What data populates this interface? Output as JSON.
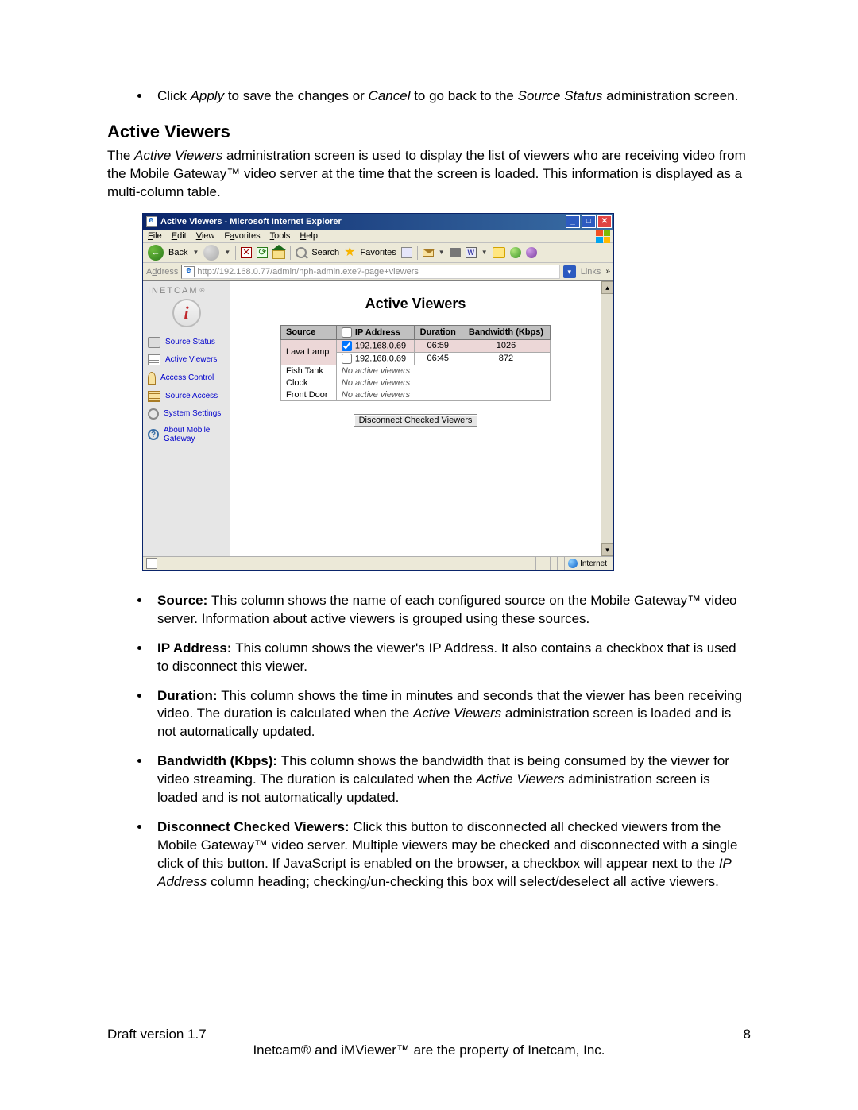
{
  "topBullet": {
    "pre": "Click ",
    "apply": "Apply",
    "mid1": " to save the changes or ",
    "cancel": "Cancel",
    "mid2": " to go back to the ",
    "srcStatus": "Source Status",
    "post": " administration screen."
  },
  "heading": "Active Viewers",
  "intro": {
    "pre": "The ",
    "term": "Active Viewers",
    "post": " administration screen is used to display the list of viewers who are receiving video from the Mobile Gateway™ video server at the time that the screen is loaded.  This information is displayed as a multi-column table."
  },
  "screenshot": {
    "title": "Active Viewers - Microsoft Internet Explorer",
    "menus": {
      "file": "File",
      "edit": "Edit",
      "view": "View",
      "favorites": "Favorites",
      "tools": "Tools",
      "help": "Help"
    },
    "toolbar": {
      "back": "Back",
      "search": "Search",
      "favorites": "Favorites"
    },
    "address": {
      "label": "Address",
      "url": "http://192.168.0.77/admin/nph-admin.exe?-page+viewers",
      "links": "Links"
    },
    "brand": "INETCAM",
    "logoGlyph": "i",
    "sidebar": [
      "Source Status",
      "Active Viewers",
      "Access Control",
      "Source Access",
      "System Settings",
      "About Mobile Gateway"
    ],
    "pageTitle": "Active Viewers",
    "table": {
      "headers": {
        "source": "Source",
        "ip": "IP Address",
        "duration": "Duration",
        "bw": "Bandwidth (Kbps)"
      },
      "rows": [
        {
          "source": "Lava Lamp",
          "viewers": [
            {
              "ip": "192.168.0.69",
              "checked": true,
              "duration": "06:59",
              "bw": "1026"
            },
            {
              "ip": "192.168.0.69",
              "checked": false,
              "duration": "06:45",
              "bw": "872"
            }
          ]
        },
        {
          "source": "Fish Tank",
          "noViewers": "No active viewers"
        },
        {
          "source": "Clock",
          "noViewers": "No active viewers"
        },
        {
          "source": "Front Door",
          "noViewers": "No active viewers"
        }
      ],
      "disconnectBtn": "Disconnect Checked Viewers"
    },
    "status": {
      "zone": "Internet"
    }
  },
  "descriptions": {
    "source": {
      "label": "Source: ",
      "text": "This column shows the name of each configured source on the Mobile Gateway™ video server.  Information about active viewers is grouped using these sources."
    },
    "ip": {
      "label": "IP Address: ",
      "text": "This column shows the viewer's IP Address.  It also contains a checkbox that is used to disconnect this viewer."
    },
    "duration": {
      "label": "Duration: ",
      "textPre": "This column shows the time in minutes and seconds that the viewer has been receiving video.  The duration is calculated when the ",
      "term": "Active Viewers",
      "textPost": " administration screen is loaded and is not automatically updated."
    },
    "bw": {
      "label": "Bandwidth (Kbps): ",
      "textPre": "This column shows the bandwidth that is being consumed by the viewer for video streaming.  The duration is calculated when the ",
      "term": "Active Viewers",
      "textPost": " administration screen is loaded and is not automatically updated."
    },
    "disc": {
      "label": "Disconnect Checked Viewers: ",
      "textPre": "Click this button to disconnected all checked viewers from the Mobile Gateway™ video server.  Multiple viewers may be checked and disconnected with a single click of this button.  If JavaScript is enabled on the browser, a checkbox will appear next to the ",
      "term": "IP Address",
      "textPost": " column heading; checking/un-checking this box will select/deselect all active viewers."
    }
  },
  "footer": {
    "draft": "Draft version 1.7",
    "page": "8",
    "copyright": "Inetcam® and iMViewer™ are the property of Inetcam, Inc."
  }
}
